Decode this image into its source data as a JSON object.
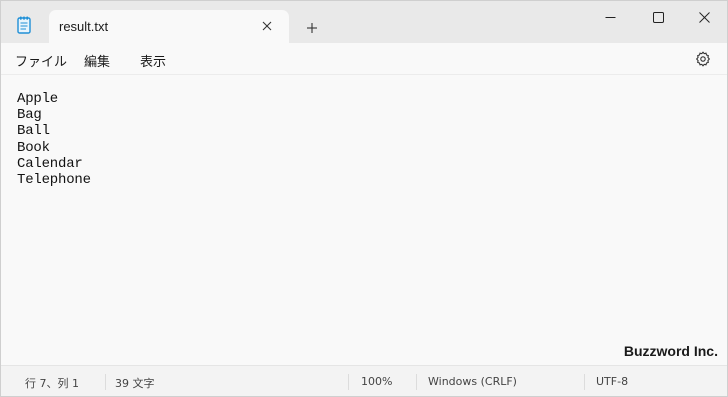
{
  "window": {
    "tab_title": "result.txt",
    "new_tab_symbol": "+"
  },
  "menu": {
    "file": "ファイル",
    "edit": "編集",
    "view": "表示"
  },
  "editor": {
    "lines": [
      "Apple",
      "Bag",
      "Ball",
      "Book",
      "Calendar",
      "Telephone"
    ]
  },
  "watermark": "Buzzword Inc.",
  "status": {
    "position": "行 7、列 1",
    "char_count": "39 文字",
    "zoom": "100%",
    "line_ending": "Windows (CRLF)",
    "encoding": "UTF-8"
  },
  "colors": {
    "titlebar": "#e9e9e9",
    "tab_active": "#f9f9f9",
    "editor_bg": "#f9f9f9",
    "statusbar": "#f3f3f3",
    "icon_accent": "#1f8fd6"
  },
  "icons": {
    "app": "notepad-icon",
    "tab_close": "close-icon",
    "new_tab": "plus-icon",
    "minimize": "minimize-icon",
    "maximize": "maximize-icon",
    "close": "close-icon",
    "settings": "gear-icon"
  }
}
